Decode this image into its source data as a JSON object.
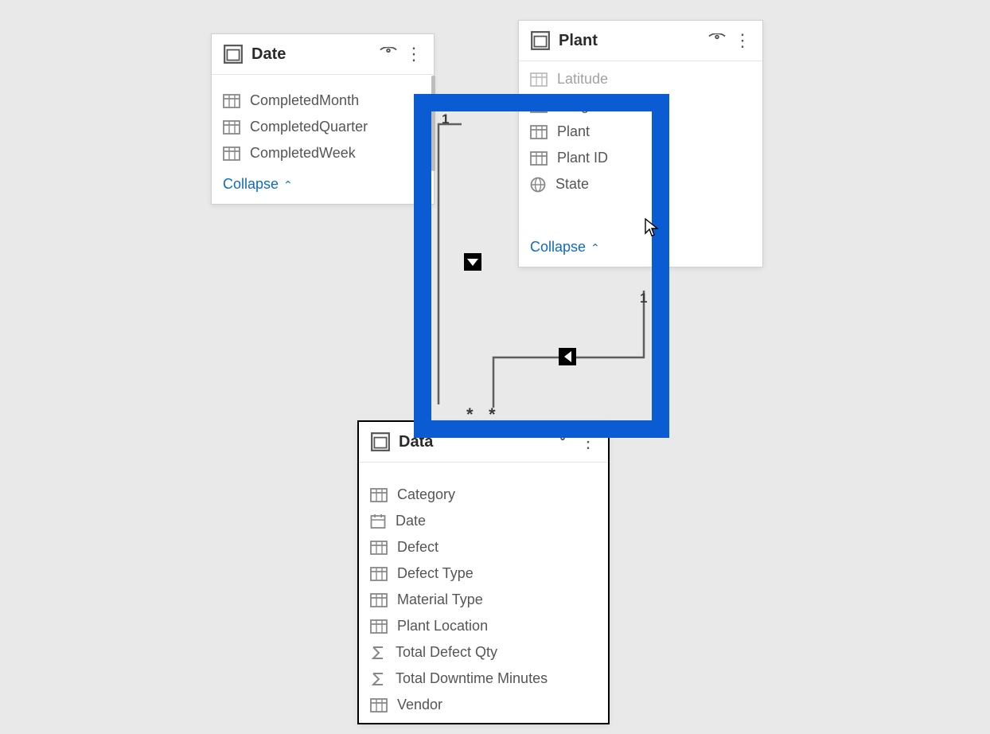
{
  "tables": {
    "date": {
      "title": "Date",
      "collapse_label": "Collapse",
      "fields": [
        {
          "name": "CompletedMonth",
          "icon": "column"
        },
        {
          "name": "CompletedQuarter",
          "icon": "column"
        },
        {
          "name": "CompletedWeek",
          "icon": "column"
        }
      ]
    },
    "plant": {
      "title": "Plant",
      "collapse_label": "Collapse",
      "fields": [
        {
          "name": "Latitude",
          "icon": "column_partial"
        },
        {
          "name": "Longitude",
          "icon": "column"
        },
        {
          "name": "Plant",
          "icon": "column"
        },
        {
          "name": "Plant ID",
          "icon": "column"
        },
        {
          "name": "State",
          "icon": "globe"
        }
      ]
    },
    "data": {
      "title": "Data",
      "fields": [
        {
          "name": "Category",
          "icon": "column"
        },
        {
          "name": "Date",
          "icon": "calendar"
        },
        {
          "name": "Defect",
          "icon": "column"
        },
        {
          "name": "Defect Type",
          "icon": "column"
        },
        {
          "name": "Material Type",
          "icon": "column"
        },
        {
          "name": "Plant Location",
          "icon": "column"
        },
        {
          "name": "Total Defect Qty",
          "icon": "sigma"
        },
        {
          "name": "Total Downtime Minutes",
          "icon": "sigma"
        },
        {
          "name": "Vendor",
          "icon": "column"
        }
      ]
    }
  },
  "relationships": [
    {
      "from_table": "Date",
      "from_card": "1",
      "to_table": "Data",
      "to_card": "*",
      "direction": "down"
    },
    {
      "from_table": "Plant",
      "from_card": "1",
      "to_table": "Data",
      "to_card": "*",
      "direction": "left"
    }
  ]
}
